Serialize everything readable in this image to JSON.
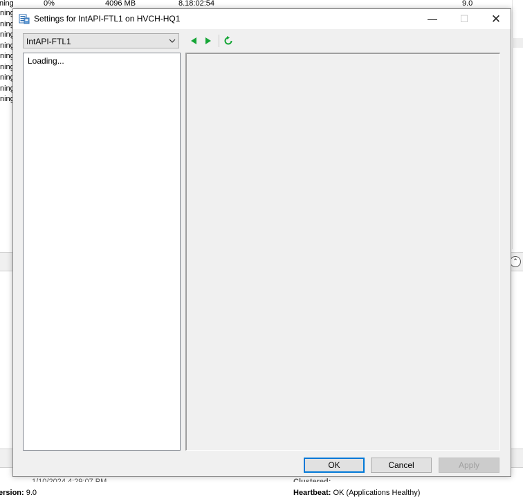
{
  "background": {
    "top_row": {
      "state": "ning",
      "cpu": "0%",
      "memory": "4096 MB",
      "uptime": "8.18:02:54",
      "version": "9.0"
    },
    "left_states": [
      "ning",
      "ning",
      "ning",
      "ning",
      "ning",
      "ning",
      "ning",
      "ning",
      "ning"
    ],
    "bottom": {
      "created_value_partial": "1/10/2024 4:29:07 PM",
      "clustered_label_partial": "Clustered:",
      "version_label": "ersion:",
      "version_value": "9.0",
      "heartbeat_label": "Heartbeat:",
      "heartbeat_value": "OK (Applications Healthy)"
    }
  },
  "dialog": {
    "title": "Settings for IntAPI-FTL1 on HVCH-HQ1",
    "window_controls": {
      "minimize": "—",
      "maximize": "☐",
      "close": "✕"
    },
    "vm_select": {
      "value": "IntAPI-FTL1"
    },
    "left_pane": {
      "status_text": "Loading..."
    },
    "buttons": {
      "ok": "OK",
      "cancel": "Cancel",
      "apply": "Apply"
    },
    "colors": {
      "accent": "#0078d7",
      "nav_green": "#16a637"
    }
  }
}
